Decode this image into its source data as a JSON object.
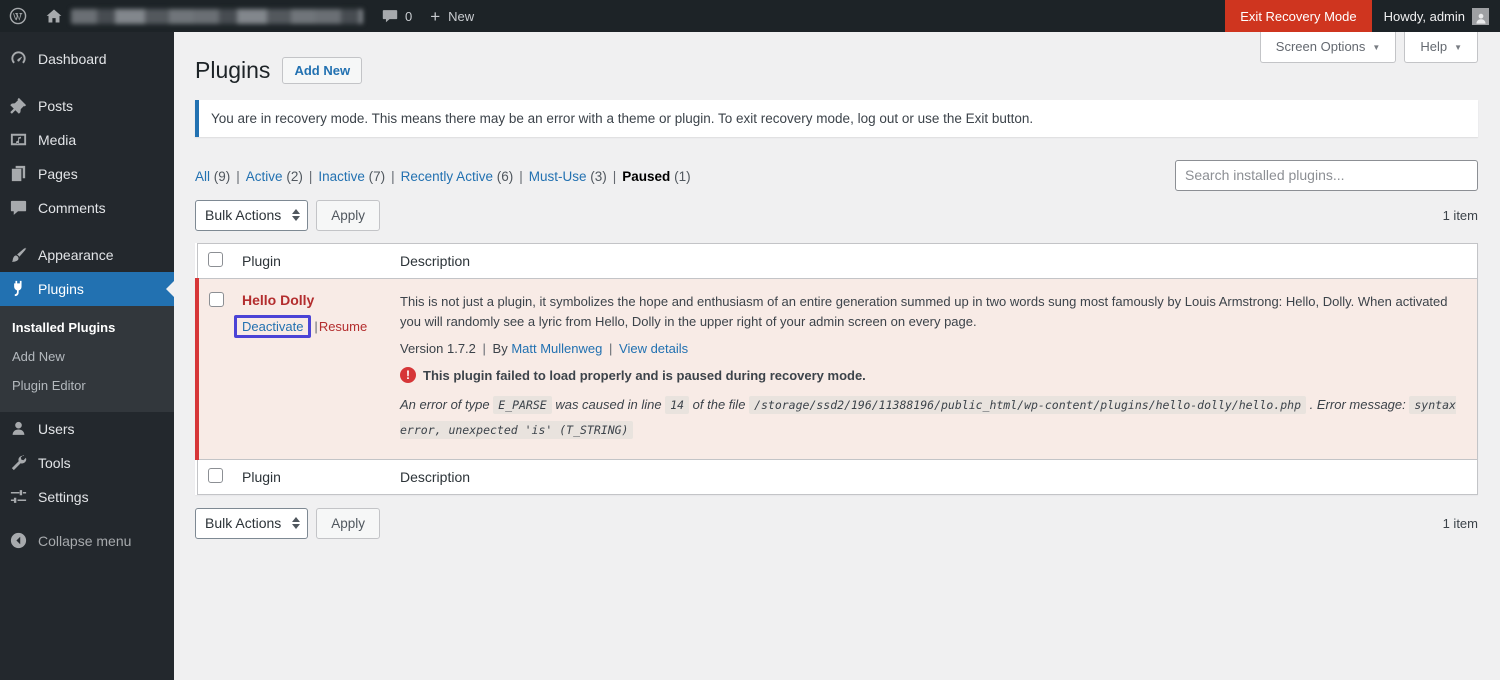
{
  "ui": {
    "pipe": "|"
  },
  "admin_bar": {
    "comments_count": "0",
    "new_label": "New",
    "exit_recovery_label": "Exit Recovery Mode",
    "howdy_label": "Howdy, admin"
  },
  "sidebar": {
    "items": [
      {
        "label": "Dashboard"
      },
      {
        "label": "Posts"
      },
      {
        "label": "Media"
      },
      {
        "label": "Pages"
      },
      {
        "label": "Comments"
      },
      {
        "label": "Appearance"
      },
      {
        "label": "Plugins"
      },
      {
        "label": "Users"
      },
      {
        "label": "Tools"
      },
      {
        "label": "Settings"
      }
    ],
    "plugins_submenu": [
      {
        "label": "Installed Plugins"
      },
      {
        "label": "Add New"
      },
      {
        "label": "Plugin Editor"
      }
    ],
    "collapse_label": "Collapse menu"
  },
  "page": {
    "title": "Plugins",
    "add_new_label": "Add New",
    "screen_options_label": "Screen Options",
    "help_label": "Help",
    "notice_text": "You are in recovery mode. This means there may be an error with a theme or plugin. To exit recovery mode, log out or use the Exit button."
  },
  "filters": {
    "items": [
      {
        "label": "All",
        "count": "(9)"
      },
      {
        "label": "Active",
        "count": "(2)"
      },
      {
        "label": "Inactive",
        "count": "(7)"
      },
      {
        "label": "Recently Active",
        "count": "(6)"
      },
      {
        "label": "Must-Use",
        "count": "(3)"
      },
      {
        "label": "Paused",
        "count": "(1)"
      }
    ],
    "search_placeholder": "Search installed plugins..."
  },
  "toolbar": {
    "bulk_actions_label": "Bulk Actions",
    "apply_label": "Apply",
    "items_count": "1 item"
  },
  "table": {
    "columns": {
      "plugin": "Plugin",
      "description": "Description"
    },
    "row": {
      "name": "Hello Dolly",
      "deactivate_label": "Deactivate",
      "resume_label": "Resume",
      "description": "This is not just a plugin, it symbolizes the hope and enthusiasm of an entire generation summed up in two words sung most famously by Louis Armstrong: Hello, Dolly. When activated you will randomly see a lyric from Hello, Dolly in the upper right of your admin screen on every page.",
      "version_label": "Version 1.7.2",
      "by_label": "By",
      "author": "Matt Mullenweg",
      "view_details_label": "View details",
      "paused_notice": "This plugin failed to load properly and is paused during recovery mode.",
      "error": {
        "prefix": "An error of type",
        "type_code": "E_PARSE",
        "middle1": "was caused in line",
        "line_code": "14",
        "middle2": "of the file",
        "file_code": "/storage/ssd2/196/11388196/public_html/wp-content/plugins/hello-dolly/hello.php",
        "suffix": ". Error message:",
        "message_code": "syntax error, unexpected 'is' (T_STRING)"
      }
    }
  },
  "colors": {
    "accent_blue": "#2271b1",
    "recovery_red": "#cf351f",
    "paused_row_red": "#d63638",
    "paused_text_red": "#b32d2e",
    "row_background": "#f8ebe6",
    "highlight_box": "#4b43d6"
  }
}
